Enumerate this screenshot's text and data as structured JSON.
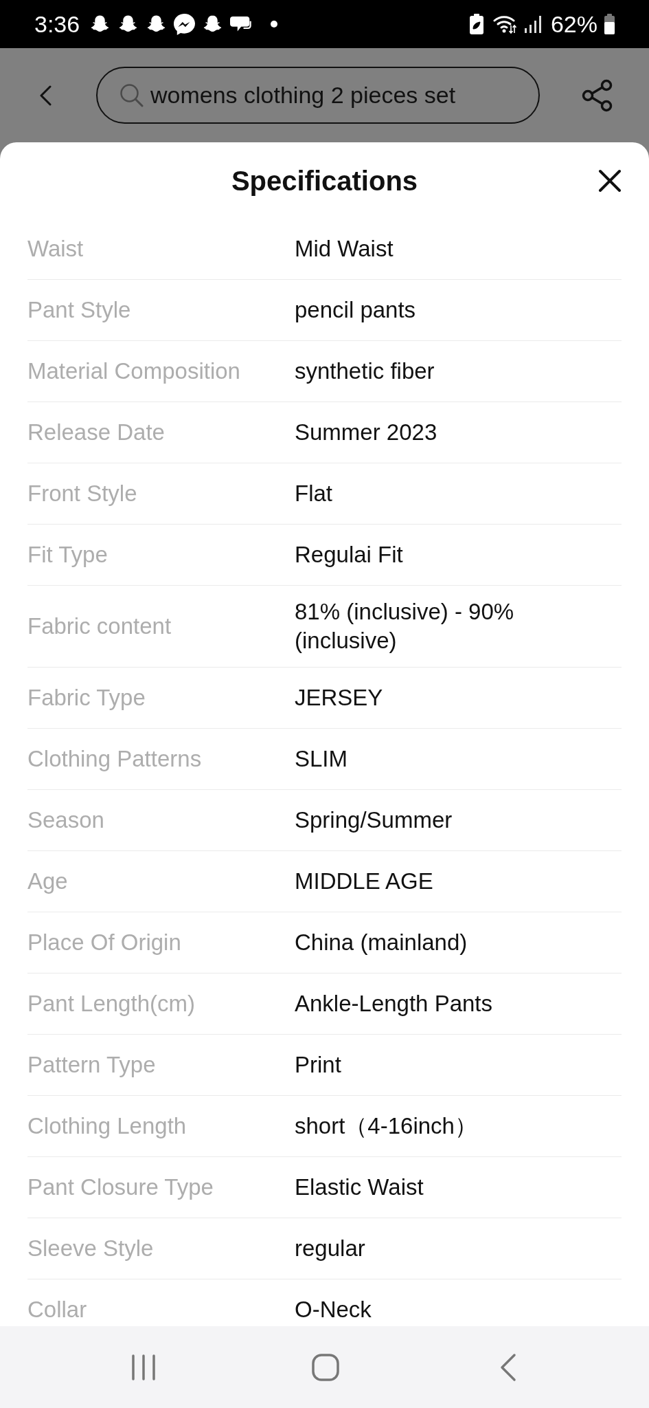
{
  "status_bar": {
    "time": "3:36",
    "battery": "62%"
  },
  "header": {
    "search": {
      "value": "womens clothing 2 pieces set"
    }
  },
  "specifications": {
    "title": "Specifications",
    "rows": [
      {
        "label": "Waist",
        "value": "Mid Waist"
      },
      {
        "label": "Pant Style",
        "value": "pencil pants"
      },
      {
        "label": "Material Composition",
        "value": "synthetic fiber"
      },
      {
        "label": "Release Date",
        "value": "Summer 2023"
      },
      {
        "label": "Front Style",
        "value": "Flat"
      },
      {
        "label": "Fit Type",
        "value": "Regulai Fit"
      },
      {
        "label": "Fabric content",
        "value": "81% (inclusive) - 90% (inclusive)"
      },
      {
        "label": "Fabric Type",
        "value": "JERSEY"
      },
      {
        "label": "Clothing Patterns",
        "value": "SLIM"
      },
      {
        "label": "Season",
        "value": "Spring/Summer"
      },
      {
        "label": "Age",
        "value": "MIDDLE AGE"
      },
      {
        "label": "Place Of Origin",
        "value": "China (mainland)"
      },
      {
        "label": "Pant Length(cm)",
        "value": "Ankle-Length Pants"
      },
      {
        "label": "Pattern Type",
        "value": "Print"
      },
      {
        "label": "Clothing Length",
        "value": "short（4-16inch）"
      },
      {
        "label": "Pant Closure Type",
        "value": "Elastic Waist"
      },
      {
        "label": "Sleeve Style",
        "value": "regular"
      },
      {
        "label": "Collar",
        "value": "O-Neck"
      }
    ]
  }
}
